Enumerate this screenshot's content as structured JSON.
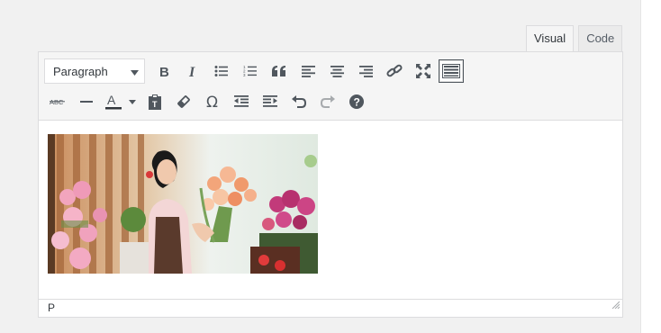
{
  "tabs": {
    "visual": "Visual",
    "code": "Code"
  },
  "toolbar": {
    "format_select": "Paragraph",
    "row1_icons": [
      "bold-icon",
      "italic-icon",
      "bullet-list-icon",
      "numbered-list-icon",
      "blockquote-icon",
      "align-left-icon",
      "align-center-icon",
      "align-right-icon",
      "link-icon",
      "fullscreen-icon",
      "toolbar-toggle-icon"
    ],
    "row2_icons": [
      "strikethrough-icon",
      "horizontal-line-icon",
      "text-color-icon",
      "paste-as-text-icon",
      "clear-formatting-icon",
      "special-character-icon",
      "outdent-icon",
      "indent-icon",
      "undo-icon",
      "redo-icon",
      "help-icon"
    ]
  },
  "statusbar": {
    "path": "P"
  },
  "colors": {
    "background": "#f1f1f1",
    "toolbar": "#f5f5f5",
    "icon": "#50575e",
    "border": "#dcdcde"
  },
  "image": {
    "description_icon": "florist-photo"
  }
}
